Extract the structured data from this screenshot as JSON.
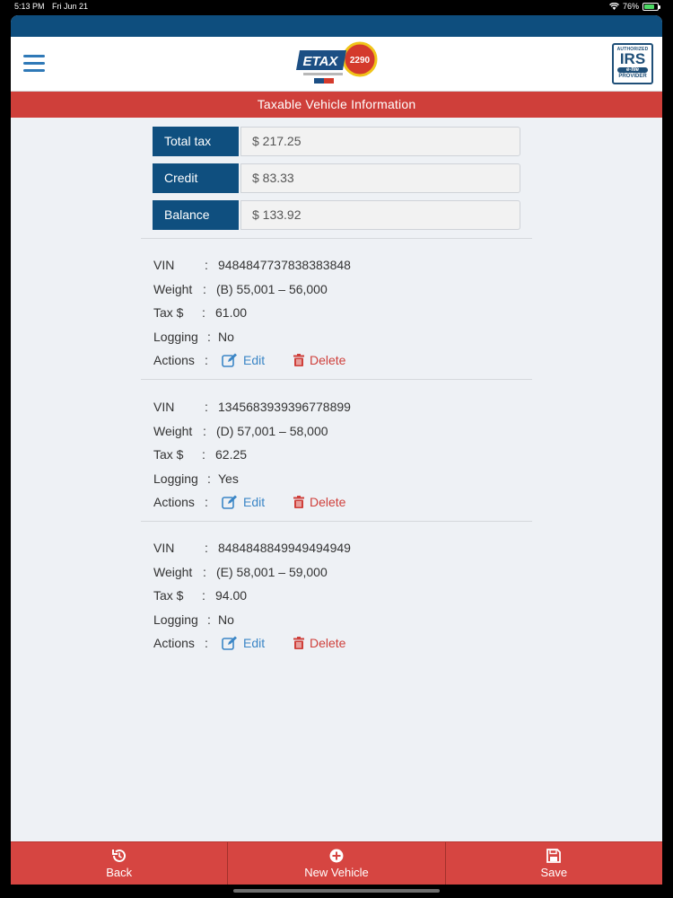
{
  "status": {
    "time": "5:13 PM",
    "date": "Fri Jun 21",
    "battery": "76%"
  },
  "header": {
    "logo_text": "ETAX",
    "logo_number": "2290",
    "irs_badge": {
      "top": "AUTHORIZED",
      "main": "IRS",
      "mid": "e-file",
      "bottom": "PROVIDER"
    }
  },
  "section_title": "Taxable Vehicle Information",
  "totals": [
    {
      "label": "Total tax",
      "value": "$ 217.25"
    },
    {
      "label": "Credit",
      "value": "$ 83.33"
    },
    {
      "label": "Balance",
      "value": "$ 133.92"
    }
  ],
  "labels": {
    "vin": "VIN",
    "weight": "Weight",
    "tax": "Tax $",
    "logging": "Logging",
    "actions": "Actions",
    "sep": ":",
    "edit": "Edit",
    "delete": "Delete"
  },
  "vehicles": [
    {
      "vin": "9484847737838383848",
      "weight": "(B) 55,001 – 56,000",
      "tax": "61.00",
      "logging": "No"
    },
    {
      "vin": "1345683939396778899",
      "weight": "(D) 57,001 – 58,000",
      "tax": "62.25",
      "logging": "Yes"
    },
    {
      "vin": "8484848849949494949",
      "weight": "(E) 58,001 – 59,000",
      "tax": "94.00",
      "logging": "No"
    }
  ],
  "bottom_nav": [
    {
      "label": "Back",
      "icon": "history-icon"
    },
    {
      "label": "New Vehicle",
      "icon": "plus-circle-icon"
    },
    {
      "label": "Save",
      "icon": "floppy-disk-icon"
    }
  ],
  "colors": {
    "navy": "#0f4f7f",
    "red": "#cf3f3a",
    "link_blue": "#3b86c6"
  }
}
